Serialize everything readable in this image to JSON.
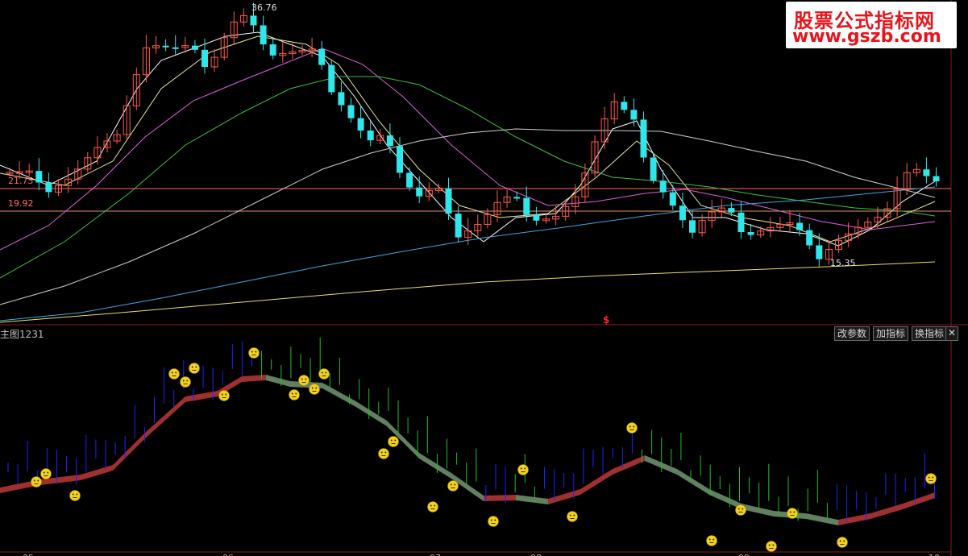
{
  "main_panel": {
    "price_labels": {
      "peak": "36.76",
      "low": "15.35",
      "level_a": "21.75",
      "level_b": "19.92"
    },
    "signal_marker": "$"
  },
  "indicator_panel": {
    "title": "主图1231",
    "buttons": {
      "modify_params": "改参数",
      "add_indicator": "加指标",
      "swap_indicator": "换指标"
    },
    "close_label": "✕"
  },
  "time_axis": {
    "labels": [
      "05",
      "06",
      "07",
      "08",
      "09",
      "10"
    ]
  },
  "watermark": {
    "line1": "股票公式指标网",
    "line2": "www.gszb.com"
  },
  "colors": {
    "up_candle": "#ff5a4a",
    "down_candle": "#2fe6ea",
    "ma5": "#ffffff",
    "ma10": "#e8e8a0",
    "ma20": "#e060e0",
    "ma30": "#40c040",
    "ma60": "#d0d0d0",
    "ma120": "#40a8e0",
    "ma250": "#e8e070",
    "hline_a": "#ff7060",
    "hline_b": "#e09060",
    "band_up": "#a03030",
    "band_down": "#608060",
    "bar_blue": "#2020ff",
    "bar_green": "#20c020",
    "emoji": "#f2d21e"
  }
}
